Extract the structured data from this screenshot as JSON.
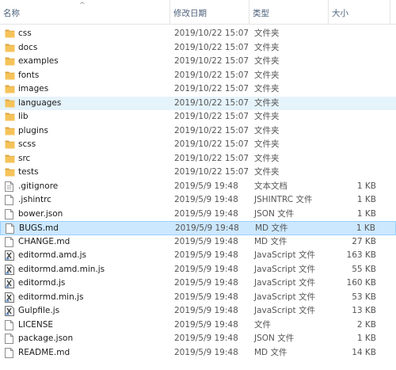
{
  "columns": {
    "name": "名称",
    "modified": "修改日期",
    "type": "类型",
    "size": "大小"
  },
  "files": [
    {
      "name": "css",
      "date": "2019/10/22 15:07",
      "type": "文件夹",
      "size": "",
      "icon": "folder-icon"
    },
    {
      "name": "docs",
      "date": "2019/10/22 15:07",
      "type": "文件夹",
      "size": "",
      "icon": "folder-icon"
    },
    {
      "name": "examples",
      "date": "2019/10/22 15:07",
      "type": "文件夹",
      "size": "",
      "icon": "folder-icon"
    },
    {
      "name": "fonts",
      "date": "2019/10/22 15:07",
      "type": "文件夹",
      "size": "",
      "icon": "folder-icon"
    },
    {
      "name": "images",
      "date": "2019/10/22 15:07",
      "type": "文件夹",
      "size": "",
      "icon": "folder-icon"
    },
    {
      "name": "languages",
      "date": "2019/10/22 15:07",
      "type": "文件夹",
      "size": "",
      "icon": "folder-icon",
      "highlight": "hover"
    },
    {
      "name": "lib",
      "date": "2019/10/22 15:07",
      "type": "文件夹",
      "size": "",
      "icon": "folder-icon"
    },
    {
      "name": "plugins",
      "date": "2019/10/22 15:07",
      "type": "文件夹",
      "size": "",
      "icon": "folder-icon"
    },
    {
      "name": "scss",
      "date": "2019/10/22 15:07",
      "type": "文件夹",
      "size": "",
      "icon": "folder-icon"
    },
    {
      "name": "src",
      "date": "2019/10/22 15:07",
      "type": "文件夹",
      "size": "",
      "icon": "folder-icon"
    },
    {
      "name": "tests",
      "date": "2019/10/22 15:07",
      "type": "文件夹",
      "size": "",
      "icon": "folder-icon"
    },
    {
      "name": ".gitignore",
      "date": "2019/5/9 19:48",
      "type": "文本文档",
      "size": "1 KB",
      "icon": "text-file-icon"
    },
    {
      "name": ".jshintrc",
      "date": "2019/5/9 19:48",
      "type": "JSHINTRC 文件",
      "size": "1 KB",
      "icon": "file-icon"
    },
    {
      "name": "bower.json",
      "date": "2019/5/9 19:48",
      "type": "JSON 文件",
      "size": "1 KB",
      "icon": "file-icon"
    },
    {
      "name": "BUGS.md",
      "date": "2019/5/9 19:48",
      "type": "MD 文件",
      "size": "1 KB",
      "icon": "file-icon",
      "highlight": "selected"
    },
    {
      "name": "CHANGE.md",
      "date": "2019/5/9 19:48",
      "type": "MD 文件",
      "size": "27 KB",
      "icon": "file-icon"
    },
    {
      "name": "editormd.amd.js",
      "date": "2019/5/9 19:48",
      "type": "JavaScript 文件",
      "size": "163 KB",
      "icon": "js-file-icon"
    },
    {
      "name": "editormd.amd.min.js",
      "date": "2019/5/9 19:48",
      "type": "JavaScript 文件",
      "size": "55 KB",
      "icon": "js-file-icon"
    },
    {
      "name": "editormd.js",
      "date": "2019/5/9 19:48",
      "type": "JavaScript 文件",
      "size": "160 KB",
      "icon": "js-file-icon"
    },
    {
      "name": "editormd.min.js",
      "date": "2019/5/9 19:48",
      "type": "JavaScript 文件",
      "size": "53 KB",
      "icon": "js-file-icon"
    },
    {
      "name": "Gulpfile.js",
      "date": "2019/5/9 19:48",
      "type": "JavaScript 文件",
      "size": "13 KB",
      "icon": "js-file-icon"
    },
    {
      "name": "LICENSE",
      "date": "2019/5/9 19:48",
      "type": "文件",
      "size": "2 KB",
      "icon": "file-icon"
    },
    {
      "name": "package.json",
      "date": "2019/5/9 19:48",
      "type": "JSON 文件",
      "size": "1 KB",
      "icon": "file-icon"
    },
    {
      "name": "README.md",
      "date": "2019/5/9 19:48",
      "type": "MD 文件",
      "size": "14 KB",
      "icon": "file-icon"
    }
  ],
  "colors": {
    "folder": "#f6c35a",
    "folder_dark": "#dba643",
    "hover_bg": "#e5f3fb",
    "selected_bg": "#cce8ff",
    "selected_border": "#99d1ff"
  }
}
